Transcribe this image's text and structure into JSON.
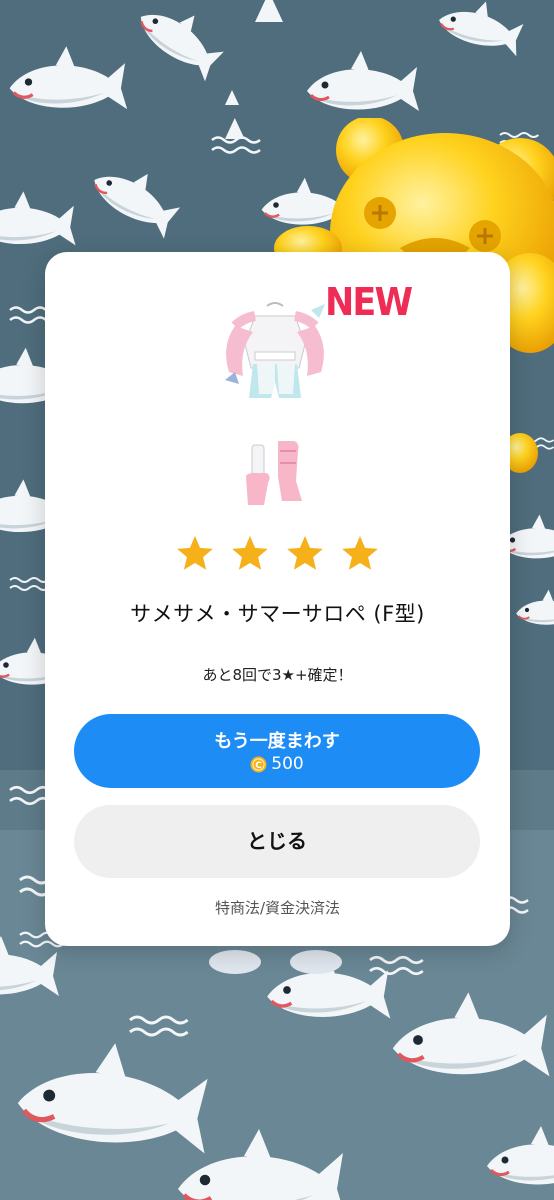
{
  "result": {
    "badge": "NEW",
    "rarity_stars": 4,
    "item_name": "サメサメ・サマーサロペ (F型)",
    "pity_text": "あと8回で3★+確定！"
  },
  "actions": {
    "spin_again_label": "もう一度まわす",
    "spin_again_cost": "500",
    "close_label": "とじる",
    "legal_link": "特商法/資金決済法"
  },
  "colors": {
    "primary_button": "#1e8cf5",
    "secondary_button": "#efefef",
    "star": "#f6b01a",
    "new_badge": "#ee2c55",
    "background": "#4f6d7c"
  },
  "icons": {
    "star": "star-icon",
    "coin": "coin-icon",
    "background_pattern": "shark-pattern",
    "mascot": "gold-bear-mascot"
  }
}
